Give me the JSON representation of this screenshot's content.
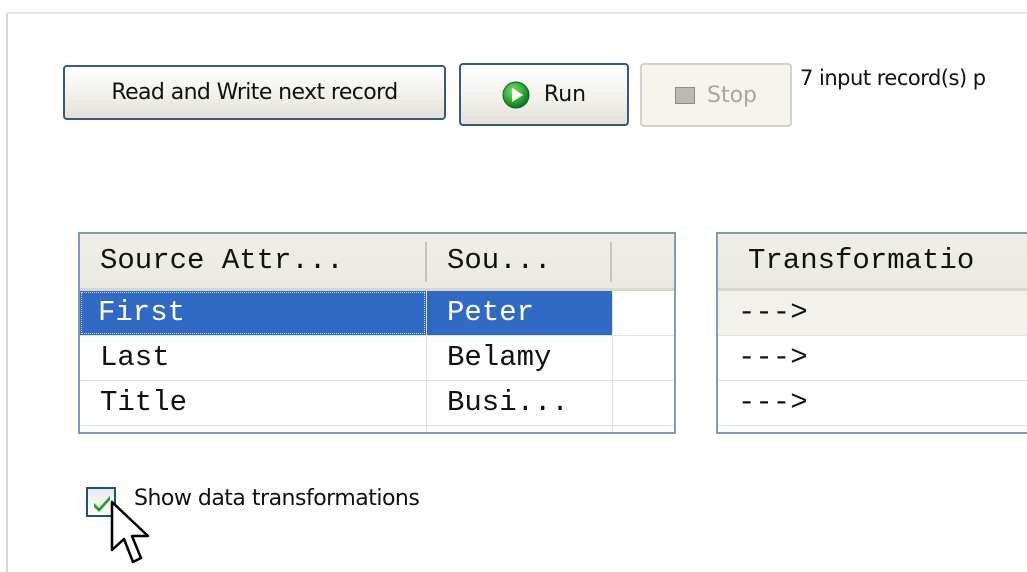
{
  "toolbar": {
    "read_write_label": "Read and Write next record",
    "run_label": "Run",
    "stop_label": "Stop",
    "status_text": "7 input record(s) p",
    "run_icon": "play-circle-icon",
    "stop_icon": "stop-square-icon"
  },
  "source_table": {
    "columns": [
      "Source Attr...",
      "Sou..."
    ],
    "rows": [
      {
        "attribute": "First",
        "value": "Peter",
        "selected": true
      },
      {
        "attribute": "Last",
        "value": "Belamy",
        "selected": false
      },
      {
        "attribute": "Title",
        "value": "Busi...",
        "selected": false
      }
    ]
  },
  "transform_table": {
    "columns": [
      "Transformatio"
    ],
    "rows": [
      "--->",
      "--->",
      "--->"
    ]
  },
  "options": {
    "show_transformations_label": "Show data transformations",
    "show_transformations_checked": true
  },
  "colors": {
    "selection": "#316ac5",
    "button_border": "#345a82",
    "checkmark": "#21a121",
    "table_border": "#7f9db9"
  }
}
